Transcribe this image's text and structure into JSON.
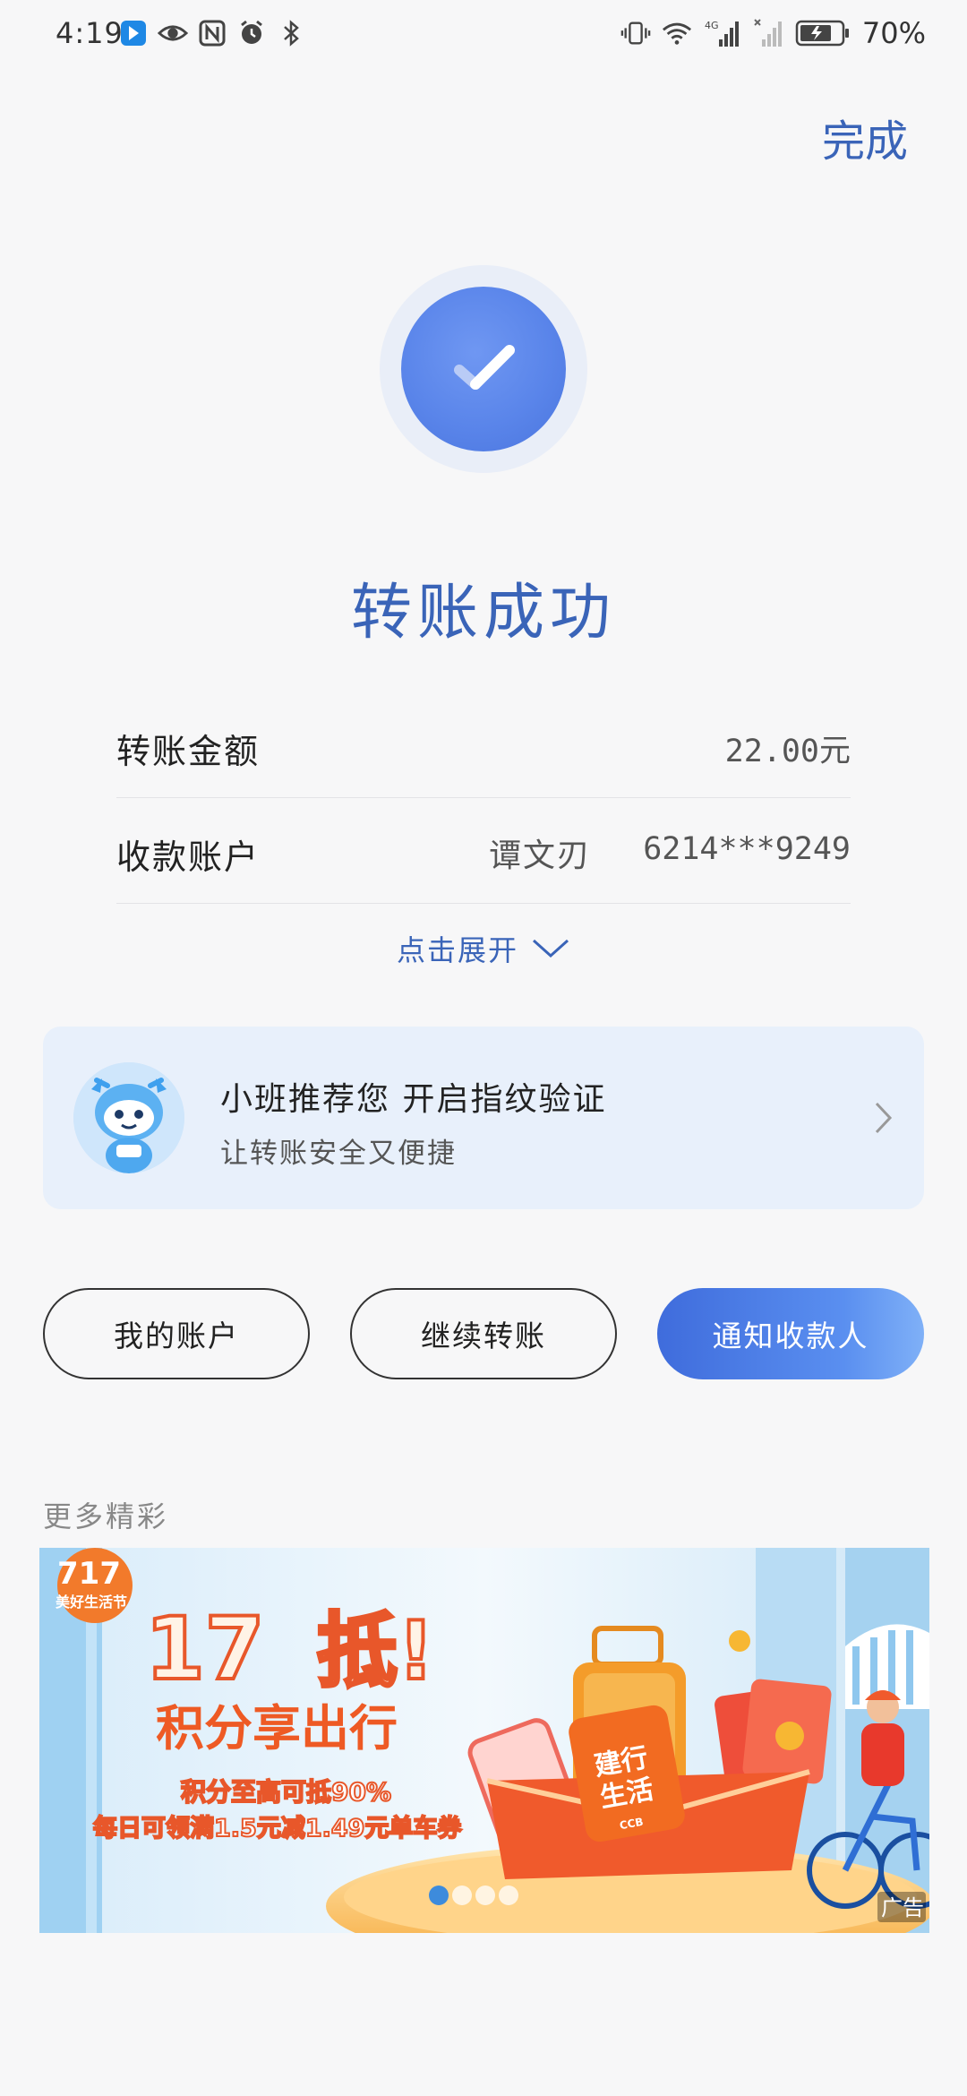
{
  "status_bar": {
    "time": "4:19",
    "battery_percent": "70%",
    "network_label": "4G",
    "left_icons": [
      "app-notification-icon",
      "eye-icon",
      "nfc-icon",
      "alarm-icon",
      "bluetooth-icon"
    ],
    "right_icons": [
      "vibrate-icon",
      "wifi-icon",
      "signal-icon",
      "signal-no-sim-icon",
      "battery-icon"
    ]
  },
  "header": {
    "done_label": "完成"
  },
  "result": {
    "title": "转账成功"
  },
  "details": {
    "amount_label": "转账金额",
    "amount_value": "22.00元",
    "payee_label": "收款账户",
    "payee_name": "谭文刃",
    "payee_account": "6214***9249",
    "expand_label": "点击展开"
  },
  "fingerprint_card": {
    "title": "小班推荐您 开启指纹验证",
    "subtitle": "让转账安全又便捷"
  },
  "actions": {
    "my_account": "我的账户",
    "continue_transfer": "继续转账",
    "notify_payee": "通知收款人"
  },
  "more": {
    "label": "更多精彩"
  },
  "banner": {
    "logo_number": "717",
    "logo_text": "美好生活节",
    "headline_number": "17",
    "headline_char": "抵!",
    "title": "积分享出行",
    "line1": "积分至高可抵90%",
    "line2": "每日可领满1.5元减1.49元单车券",
    "card_text_1": "建行",
    "card_text_2": "生活",
    "card_brand": "CCB",
    "ad_label": "广告",
    "slide_count": 4,
    "active_slide": 1
  },
  "colors": {
    "accent": "#3a64b8",
    "primary_button": "#4a7be4",
    "card_bg": "#e8f0fb",
    "page_bg": "#f7f7f8"
  }
}
